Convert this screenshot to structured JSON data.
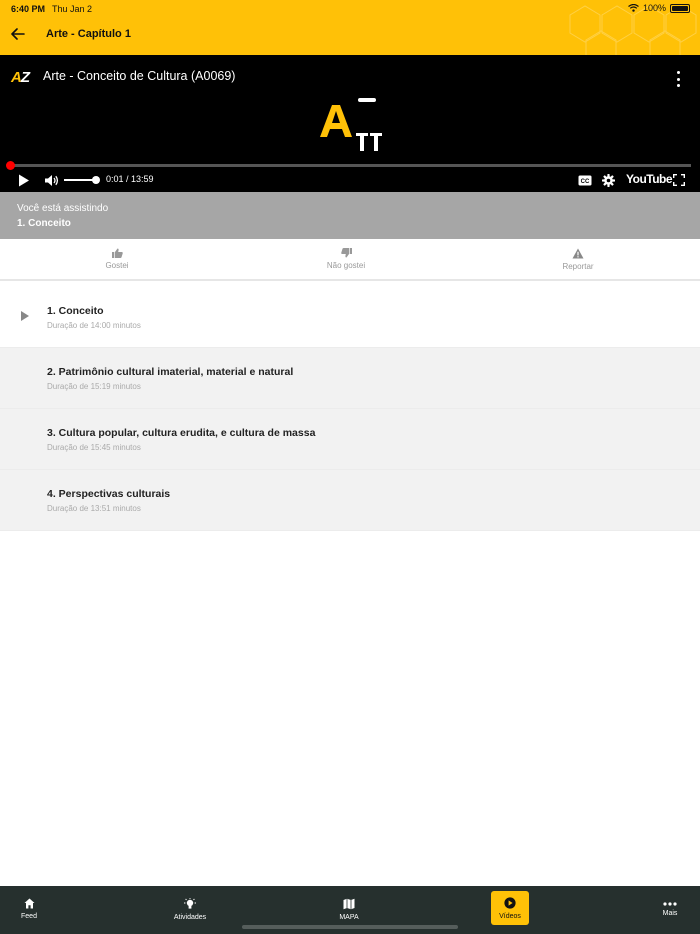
{
  "status_bar": {
    "time": "6:40 PM",
    "date": "Thu Jan 2",
    "battery": "100%"
  },
  "header": {
    "title": "Arte - Capítulo 1"
  },
  "player": {
    "logo_a": "A",
    "logo_z": "Z",
    "video_title": "Arte - Conceito de Cultura (A0069)",
    "time_current": "0:01 / 13:59",
    "youtube_label": "YouTube",
    "cc_label": "CC",
    "progress": 0.0012,
    "volume": 1.0
  },
  "watching": {
    "label": "Você está assistindo",
    "current": "1. Conceito"
  },
  "reactions": {
    "like": "Gostei",
    "dislike": "Não gostei",
    "report": "Reportar"
  },
  "episodes": [
    {
      "title": "1. Conceito",
      "duration": "Duração de 14:00 minutos",
      "playing": true
    },
    {
      "title": "2. Patrimônio cultural imaterial, material e natural",
      "duration": "Duração de 15:19 minutos",
      "playing": false
    },
    {
      "title": "3. Cultura popular, cultura erudita, e cultura de massa",
      "duration": "Duração de 15:45 minutos",
      "playing": false
    },
    {
      "title": "4. Perspectivas culturais",
      "duration": "Duração de 13:51 minutos",
      "playing": false
    }
  ],
  "tabs": [
    {
      "label": "Feed",
      "icon": "home-icon"
    },
    {
      "label": "Atividades",
      "icon": "lightbulb-icon"
    },
    {
      "label": "MAPA",
      "icon": "map-icon"
    },
    {
      "label": "Vídeos",
      "icon": "play-circle-icon",
      "active": true
    },
    {
      "label": "Mais",
      "icon": "more-icon"
    }
  ],
  "colors": {
    "brand_yellow": "#FFC107",
    "tabbar_bg": "#26302e",
    "watching_bg": "#a6a6a6",
    "progress_red": "#ff0000"
  }
}
